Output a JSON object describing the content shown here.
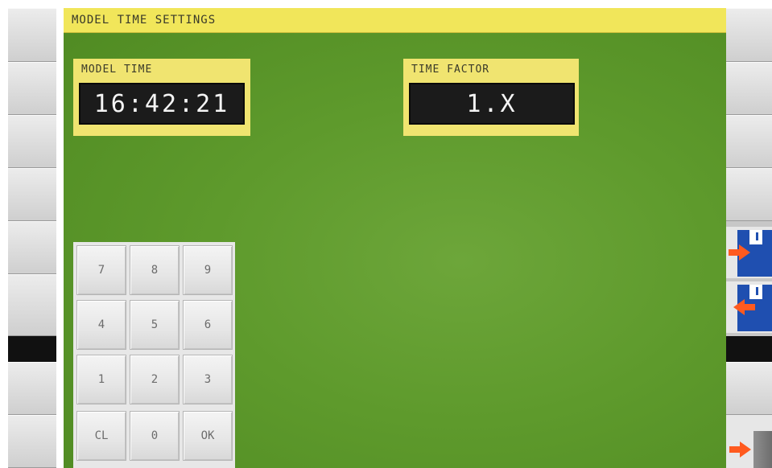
{
  "screen": {
    "title": "MODEL TIME SETTINGS"
  },
  "model_time": {
    "label": "MODEL TIME",
    "value": "16:42:21"
  },
  "time_factor": {
    "label": "TIME FACTOR",
    "value": "1.X"
  },
  "keypad": {
    "keys": [
      "7",
      "8",
      "9",
      "4",
      "5",
      "6",
      "1",
      "2",
      "3",
      "CL",
      "0",
      "OK"
    ]
  },
  "icons": {
    "save": "floppy-save-arrow-right-icon",
    "load": "floppy-load-arrow-left-icon",
    "exit": "exit-arrow-icon"
  },
  "colors": {
    "display_green": "#5e9a2c",
    "title_yellow": "#f1e65a",
    "accent_orange": "#ff5a1f",
    "floppy_blue": "#1f4fb0"
  }
}
